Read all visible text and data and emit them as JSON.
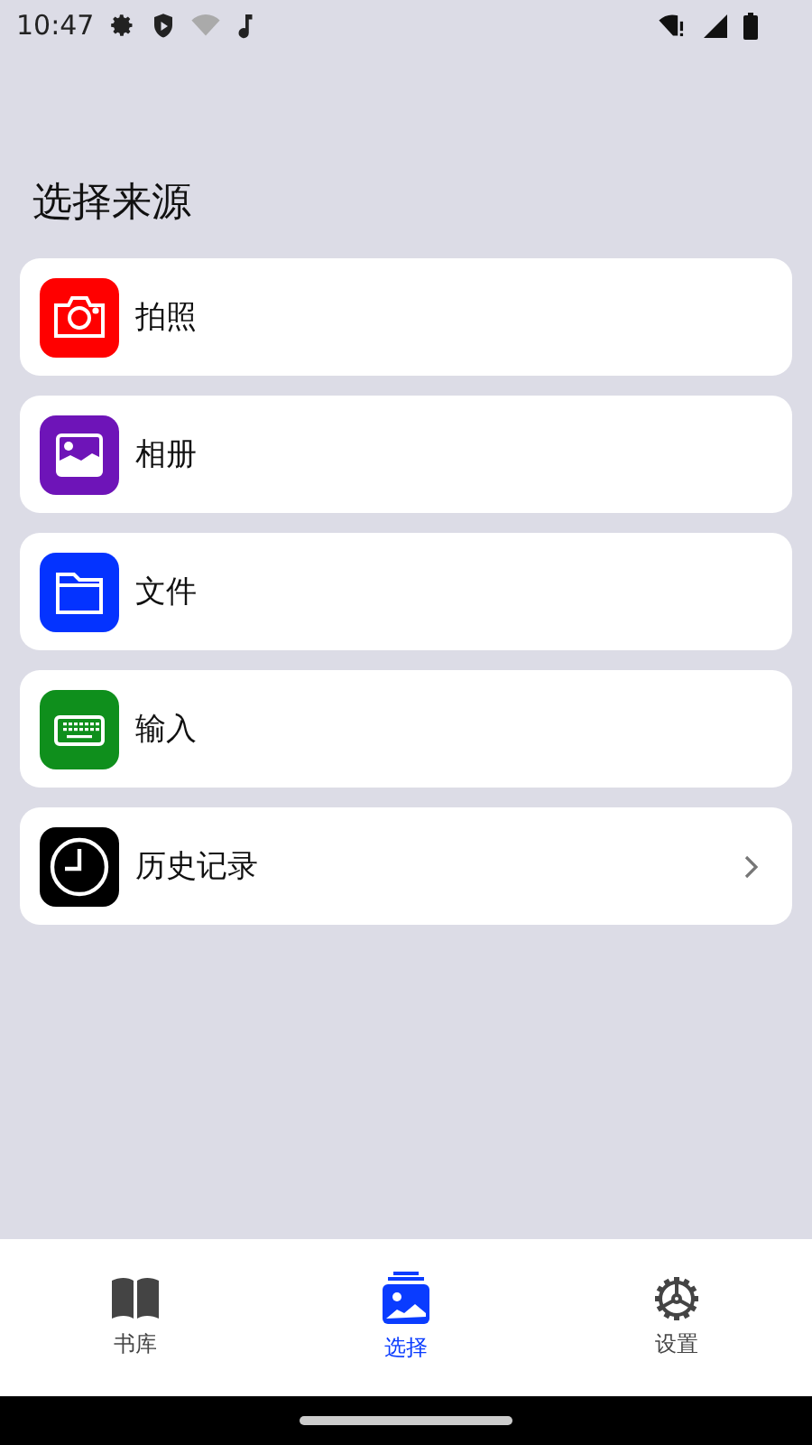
{
  "status_bar": {
    "time": "10:47"
  },
  "title": "选择来源",
  "sources": [
    {
      "label": "拍照",
      "kind": "camera",
      "color": "#ff0000",
      "chevron": false
    },
    {
      "label": "相册",
      "kind": "photo",
      "color": "#6e14b8",
      "chevron": false
    },
    {
      "label": "文件",
      "kind": "folder",
      "color": "#0433ff",
      "chevron": false
    },
    {
      "label": "输入",
      "kind": "keyboard",
      "color": "#0f8f1c",
      "chevron": false
    },
    {
      "label": "历史记录",
      "kind": "clock",
      "color": "#000000",
      "chevron": true
    }
  ],
  "tabs": [
    {
      "label": "书库",
      "kind": "book",
      "selected": false
    },
    {
      "label": "选择",
      "kind": "photos",
      "selected": true
    },
    {
      "label": "设置",
      "kind": "gear",
      "selected": false
    }
  ]
}
